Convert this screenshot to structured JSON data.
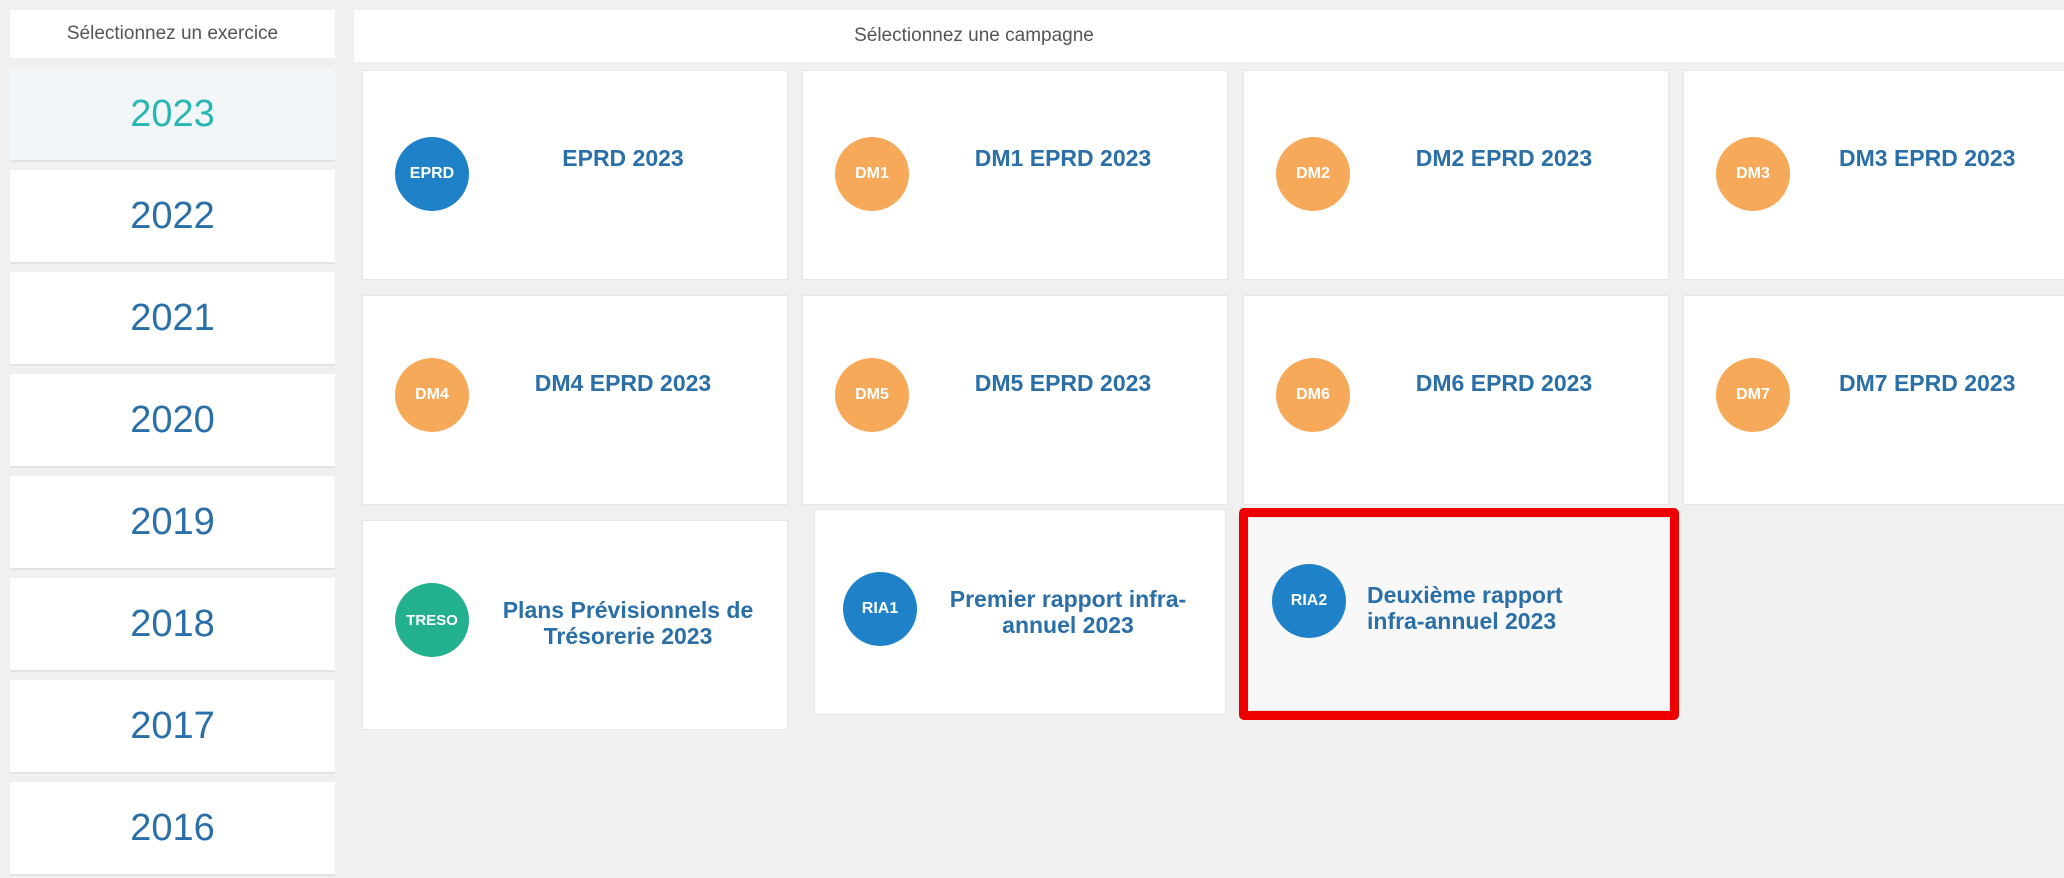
{
  "sidebar": {
    "header": "Sélectionnez un exercice",
    "years": [
      "2023",
      "2022",
      "2021",
      "2020",
      "2019",
      "2018",
      "2017",
      "2016"
    ]
  },
  "main": {
    "header": "Sélectionnez une campagne",
    "cards": [
      {
        "badge": "EPRD",
        "title": "EPRD 2023"
      },
      {
        "badge": "DM1",
        "title": "DM1 EPRD 2023"
      },
      {
        "badge": "DM2",
        "title": "DM2 EPRD 2023"
      },
      {
        "badge": "DM3",
        "title": "DM3 EPRD 2023"
      },
      {
        "badge": "DM4",
        "title": "DM4 EPRD 2023"
      },
      {
        "badge": "DM5",
        "title": "DM5 EPRD 2023"
      },
      {
        "badge": "DM6",
        "title": "DM6 EPRD 2023"
      },
      {
        "badge": "DM7",
        "title": "DM7 EPRD 2023"
      },
      {
        "badge": "TRESO",
        "title": "Plans Prévisionnels de Trésorerie 2023"
      },
      {
        "badge": "RIA1",
        "title": "Premier rapport infra-annuel 2023"
      },
      {
        "badge": "RIA2",
        "title": "Deuxième rapport infra-annuel 2023"
      }
    ]
  },
  "colors": {
    "blue_badge": "#1f82c8",
    "orange_badge": "#f7a95a",
    "green_badge": "#23b08e",
    "title_blue": "#2a6fa8",
    "active_year": "#28b6b5",
    "highlight_red": "#ee0000"
  }
}
